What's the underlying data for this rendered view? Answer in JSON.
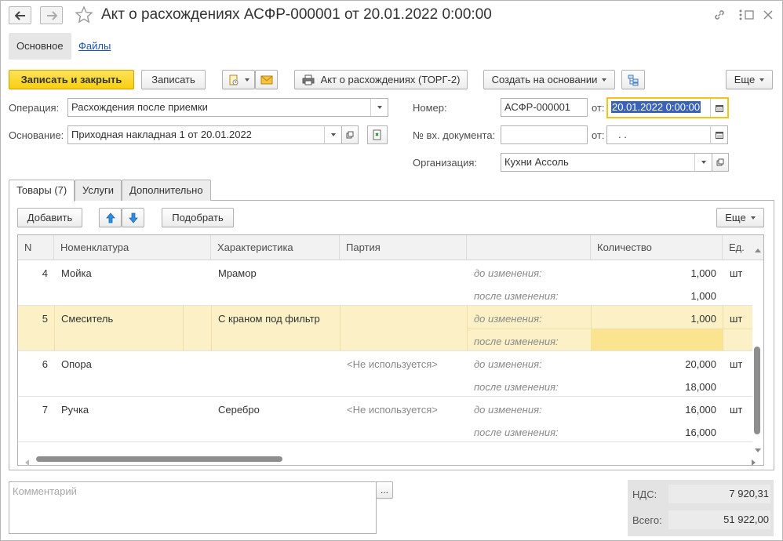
{
  "window": {
    "title": "Акт о расхождениях АСФР-000001 от 20.01.2022 0:00:00"
  },
  "sections": {
    "main": "Основное",
    "files": "Файлы"
  },
  "toolbar": {
    "save_close": "Записать и закрыть",
    "save": "Записать",
    "print_act": "Акт о расхождениях (ТОРГ-2)",
    "create_based": "Создать на основании",
    "more": "Еще"
  },
  "form": {
    "operation_label": "Операция:",
    "operation_value": "Расхождения после приемки",
    "basis_label": "Основание:",
    "basis_value": "Приходная накладная 1 от 20.01.2022",
    "number_label": "Номер:",
    "number_value": "АСФР-000001",
    "from_label": "от:",
    "date_value": "20.01.2022  0:00:00",
    "in_doc_label": "№ вх. документа:",
    "in_doc_value": "",
    "in_doc_from_label": "от:",
    "in_doc_date": " .  .",
    "org_label": "Организация:",
    "org_value": "Кухни Ассоль"
  },
  "tabs": [
    {
      "label": "Товары (7)"
    },
    {
      "label": "Услуги"
    },
    {
      "label": "Дополнительно"
    }
  ],
  "table_toolbar": {
    "add": "Добавить",
    "pick": "Подобрать",
    "more": "Еще"
  },
  "table": {
    "columns": [
      "N",
      "Номенклатура",
      "Характеристика",
      "Партия",
      "",
      "Количество",
      "Ед."
    ],
    "rows": [
      {
        "n": "4",
        "item": "Мойка",
        "char": "Мрамор",
        "batch": "",
        "before_label": "до изменения:",
        "after_label": "после изменения:",
        "qty_before": "1,000",
        "qty_after": "1,000",
        "unit": "шт"
      },
      {
        "n": "5",
        "item": "Смеситель",
        "char": "С краном под фильтр",
        "batch": "",
        "before_label": "до изменения:",
        "after_label": "после изменения:",
        "qty_before": "1,000",
        "qty_after": "",
        "unit": "шт"
      },
      {
        "n": "6",
        "item": "Опора",
        "char": "",
        "batch": "<Не используется>",
        "before_label": "до изменения:",
        "after_label": "после изменения:",
        "qty_before": "20,000",
        "qty_after": "18,000",
        "unit": "шт"
      },
      {
        "n": "7",
        "item": "Ручка",
        "char": "Серебро",
        "batch": "<Не используется>",
        "before_label": "до изменения:",
        "after_label": "после изменения:",
        "qty_before": "16,000",
        "qty_after": "16,000",
        "unit": "шт"
      }
    ]
  },
  "comment": {
    "placeholder": "Комментарий",
    "btn": "..."
  },
  "totals": {
    "vat_label": "НДС:",
    "vat_value": "7 920,31",
    "total_label": "Всего:",
    "total_value": "51 922,00"
  },
  "colors": {
    "primary_button": "#f7cf10",
    "selected_row": "#fbf0c6",
    "link": "#1b54a6",
    "date_highlight": "#3a63b8"
  }
}
